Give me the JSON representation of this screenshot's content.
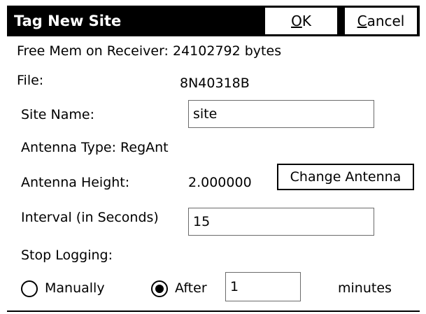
{
  "dialog": {
    "title": "Tag New Site",
    "ok": {
      "mnemonic": "O",
      "rest": "K"
    },
    "cancel": {
      "mnemonic": "C",
      "rest": "ancel"
    }
  },
  "free_mem": "Free Mem on Receiver: 24102792 bytes",
  "file": {
    "label": "File:",
    "value": "8N40318B"
  },
  "site_name": {
    "label": "Site Name:",
    "value": "site"
  },
  "antenna_type": "Antenna Type: RegAnt",
  "antenna_height": {
    "label": "Antenna Height:",
    "value": "2.000000",
    "button": "Change Antenna"
  },
  "interval": {
    "label": "Interval (in Seconds)",
    "value": "15"
  },
  "stop_logging": {
    "label": "Stop Logging:",
    "manually": "Manually",
    "after": "After",
    "selected": "after",
    "after_value": "1",
    "unit": "minutes"
  }
}
